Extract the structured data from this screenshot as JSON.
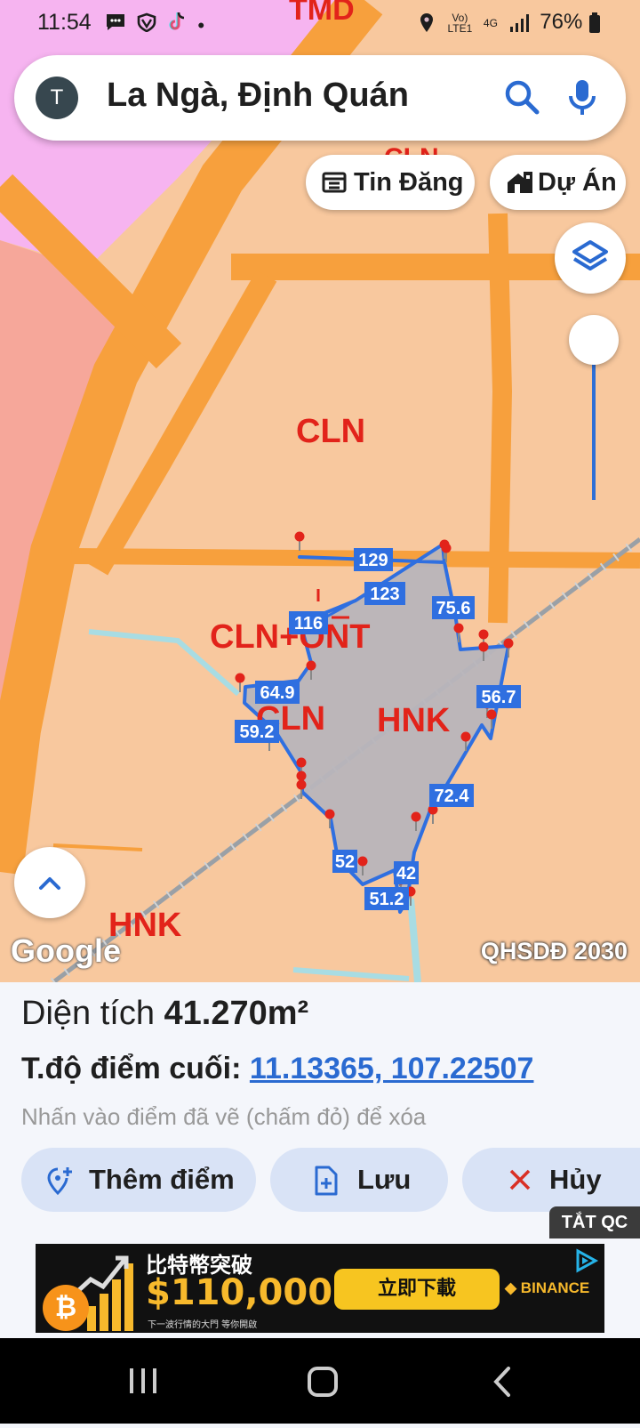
{
  "status_bar": {
    "time": "11:54",
    "left_icons": [
      "message-icon",
      "shield-icon",
      "tiktok-icon",
      "dot-icon"
    ],
    "network_top": "Vo)",
    "network_bottom": "LTE1",
    "net4g": "4G",
    "battery": "76%"
  },
  "search": {
    "avatar_letter": "T",
    "query": "La Ngà, Định Quán"
  },
  "chips": {
    "listings": "Tin Đăng",
    "projects": "Dự Án"
  },
  "map": {
    "zone_labels": [
      "TMD",
      "CLN",
      "CLN",
      "CLN+ONT",
      "CLN",
      "HNK",
      "HNK"
    ],
    "edge_lengths": [
      "129",
      "123",
      "75.6",
      "116",
      "64.9",
      "59.2",
      "56.7",
      "72.4",
      "52",
      "42",
      "51.2"
    ],
    "google_logo": "Google",
    "plan_label": "QHSDĐ 2030",
    "colors": {
      "agri_land": "#f8c89e",
      "road": "#f7a03d",
      "commercial": "#f6b4f0",
      "residential": "#f6a79a",
      "polygon_stroke": "#2f6fe0",
      "polygon_fill": "#b8b5ba",
      "marker": "#e2231a"
    }
  },
  "panel": {
    "area_label": "Diện tích",
    "area_value": "41.270m²",
    "coord_label": "T.độ điểm cuối:",
    "coord_value": "11.13365, 107.22507",
    "hint": "Nhấn vào điểm đã vẽ (chấm đỏ) để xóa",
    "add_point": "Thêm điểm",
    "save": "Lưu",
    "cancel": "Hủy",
    "ads_off": "TẮT QC"
  },
  "ad": {
    "headline": "比特幣突破",
    "price": "$110,000!",
    "cta": "立即下載",
    "brand": "BINANCE",
    "tagline": "下一波行情的大門 等你開啟",
    "coin_symbol": "₿"
  }
}
